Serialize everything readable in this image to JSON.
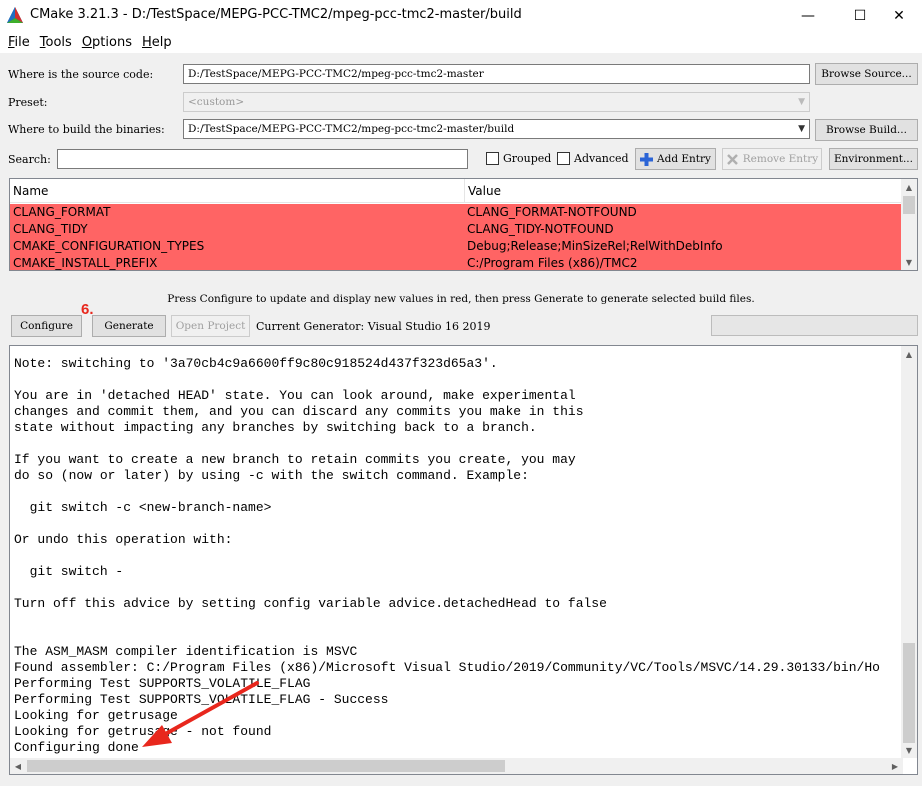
{
  "window": {
    "title": "CMake 3.21.3 - D:/TestSpace/MEPG-PCC-TMC2/mpeg-pcc-tmc2-master/build",
    "controls": {
      "minimize": "—",
      "maximize": "☐",
      "close": "✕"
    },
    "logo_icon": "cmake-triangle-logo"
  },
  "menu": {
    "items": [
      {
        "label_first": "F",
        "label_rest": "ile"
      },
      {
        "label_first": "T",
        "label_rest": "ools"
      },
      {
        "label_first": "O",
        "label_rest": "ptions"
      },
      {
        "label_first": "H",
        "label_rest": "elp"
      }
    ]
  },
  "source": {
    "label": "Where is the source code:",
    "value": "D:/TestSpace/MEPG-PCC-TMC2/mpeg-pcc-tmc2-master",
    "browse_label": "Browse Source..."
  },
  "preset": {
    "label": "Preset:",
    "value": "<custom>"
  },
  "build": {
    "label": "Where to build the binaries:",
    "value": "D:/TestSpace/MEPG-PCC-TMC2/mpeg-pcc-tmc2-master/build",
    "browse_label": "Browse Build..."
  },
  "search": {
    "label": "Search:",
    "value": "",
    "grouped_label": "Grouped",
    "advanced_label": "Advanced",
    "add_entry_label": "Add Entry",
    "remove_entry_label": "Remove Entry",
    "environment_label": "Environment..."
  },
  "cache": {
    "columns": [
      "Name",
      "Value"
    ],
    "rows": [
      {
        "name": "CLANG_FORMAT",
        "value": "CLANG_FORMAT-NOTFOUND"
      },
      {
        "name": "CLANG_TIDY",
        "value": "CLANG_TIDY-NOTFOUND"
      },
      {
        "name": "CMAKE_CONFIGURATION_TYPES",
        "value": "Debug;Release;MinSizeRel;RelWithDebInfo"
      },
      {
        "name": "CMAKE_INSTALL_PREFIX",
        "value": "C:/Program Files (x86)/TMC2"
      }
    ],
    "row_color": "#ff6464"
  },
  "hint": "Press Configure to update and display new values in red, then press Generate to generate selected build files.",
  "actions": {
    "configure_label": "Configure",
    "generate_label": "Generate",
    "open_project_label": "Open Project",
    "generator_text": "Current Generator: Visual Studio 16 2019",
    "step_annotation": "6.",
    "progress": 0
  },
  "output": {
    "lines": [
      "Note: switching to '3a70cb4c9a6600ff9c80c918524d437f323d65a3'.",
      "",
      "You are in 'detached HEAD' state. You can look around, make experimental",
      "changes and commit them, and you can discard any commits you make in this",
      "state without impacting any branches by switching back to a branch.",
      "",
      "If you want to create a new branch to retain commits you create, you may",
      "do so (now or later) by using -c with the switch command. Example:",
      "",
      "  git switch -c <new-branch-name>",
      "",
      "Or undo this operation with:",
      "",
      "  git switch -",
      "",
      "Turn off this advice by setting config variable advice.detachedHead to false",
      "",
      "",
      "The ASM_MASM compiler identification is MSVC",
      "Found assembler: C:/Program Files (x86)/Microsoft Visual Studio/2019/Community/VC/Tools/MSVC/14.29.30133/bin/Ho",
      "Performing Test SUPPORTS_VOLATILE_FLAG",
      "Performing Test SUPPORTS_VOLATILE_FLAG - Success",
      "Looking for getrusage",
      "Looking for getrusage - not found",
      "Configuring done"
    ]
  },
  "colors": {
    "annotation_red": "#e8271d",
    "cache_row": "#ff6464"
  }
}
